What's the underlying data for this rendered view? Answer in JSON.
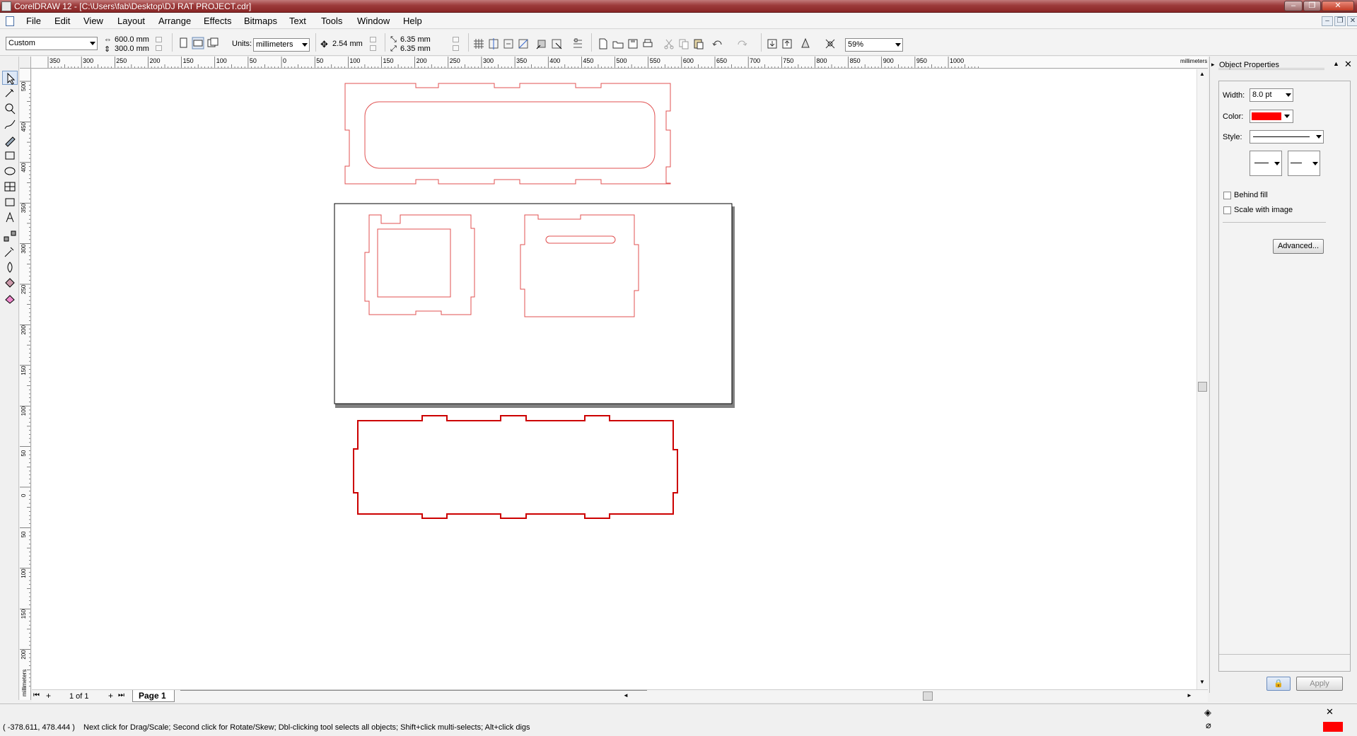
{
  "window": {
    "title": "CorelDRAW 12 - [C:\\Users\\fab\\Desktop\\DJ RAT PROJECT.cdr]",
    "controls": {
      "minimize": "–",
      "restore": "❐",
      "close": "✕"
    }
  },
  "menu": {
    "items": [
      "File",
      "Edit",
      "View",
      "Layout",
      "Arrange",
      "Effects",
      "Bitmaps",
      "Text",
      "Tools",
      "Window",
      "Help"
    ]
  },
  "propbar": {
    "paper_preset": "Custom",
    "page_width": "600.0 mm",
    "page_height": "300.0 mm",
    "units_label": "Units:",
    "units_value": "millimeters",
    "nudge": "2.54 mm",
    "dup_x": "6.35 mm",
    "dup_y": "6.35 mm",
    "zoom": "59%"
  },
  "ruler": {
    "h_ticks": [
      "350",
      "300",
      "250",
      "200",
      "150",
      "100",
      "50",
      "0",
      "50",
      "100",
      "150",
      "200",
      "250",
      "300",
      "350",
      "400",
      "450",
      "500",
      "550",
      "600",
      "650",
      "700",
      "750",
      "800",
      "850",
      "900",
      "950",
      "1000"
    ],
    "h_unit": "millimeters",
    "v_ticks": [
      "500",
      "450",
      "400",
      "350",
      "300",
      "250",
      "200",
      "150",
      "100",
      "50",
      "0",
      "50",
      "100",
      "150",
      "200"
    ],
    "v_unit": "millimeters"
  },
  "pages": {
    "counter": "1 of 1",
    "tab_label": "Page 1"
  },
  "docker": {
    "title": "Object Properties",
    "width_label": "Width:",
    "width_value": "8.0 pt",
    "color_label": "Color:",
    "color_value": "#ff0000",
    "style_label": "Style:",
    "behind_fill": "Behind fill",
    "scale_with_image": "Scale with image",
    "advanced_button": "Advanced...",
    "apply_button": "Apply"
  },
  "status": {
    "coords": "( -378.611, 478.444 )",
    "message": "Next click for Drag/Scale; Second click for Rotate/Skew; Dbl-clicking tool selects all objects; Shift+click multi-selects; Alt+click digs"
  },
  "colors": {
    "outline": "#e05050",
    "outline_selected": "#cc0000",
    "swatch_red": "#ff0000"
  }
}
